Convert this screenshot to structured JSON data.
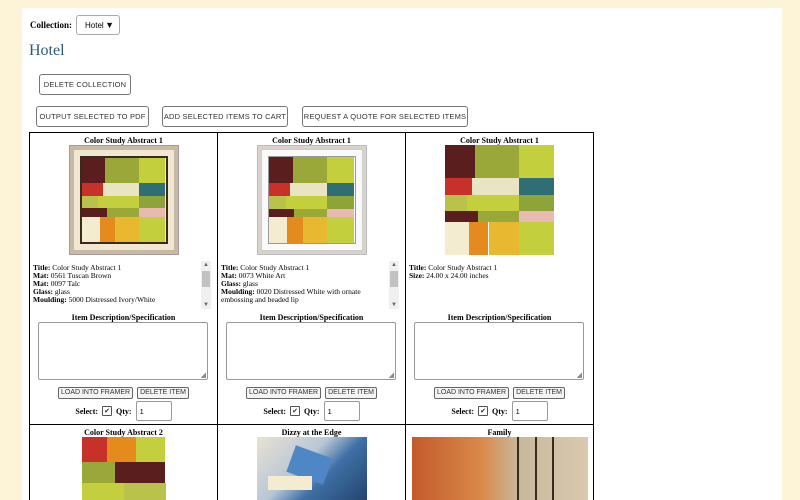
{
  "collection": {
    "label": "Collection:",
    "selected": "Hotel"
  },
  "page_title": "Hotel",
  "buttons": {
    "delete_collection": "DELETE COLLECTION",
    "output_pdf": "OUTPUT SELECTED TO PDF",
    "add_cart": "ADD SELECTED ITEMS TO CART",
    "request_quote": "REQUEST A QUOTE FOR SELECTED ITEMS"
  },
  "labels": {
    "item_desc": "Item Description/Specification",
    "load_framer": "LOAD INTO FRAMER",
    "delete_item": "DELETE ITEM",
    "select": "Select:",
    "qty": "Qty:",
    "check": "✔"
  },
  "items": [
    {
      "title": "Color Study Abstract 1",
      "specs": [
        {
          "k": "Title:",
          "v": "Color Study Abstract 1"
        },
        {
          "k": "Mat:",
          "v": "0561 Tuscan Brown"
        },
        {
          "k": "Mat:",
          "v": "0097 Talc"
        },
        {
          "k": "Glass:",
          "v": "glass"
        },
        {
          "k": "Moulding:",
          "v": "5000 Distressed Ivory/White"
        }
      ],
      "qty": "1"
    },
    {
      "title": "Color Study Abstract 1",
      "specs": [
        {
          "k": "Title:",
          "v": "Color Study Abstract 1"
        },
        {
          "k": "Mat:",
          "v": "0073 White Art"
        },
        {
          "k": "Glass:",
          "v": "glass"
        },
        {
          "k": "Moulding:",
          "v": "0020 Distressed White with ornate embossing and beaded lip"
        }
      ],
      "qty": "1"
    },
    {
      "title": "Color Study Abstract 1",
      "specs": [
        {
          "k": "Title:",
          "v": "Color Study Abstract 1"
        },
        {
          "k": "Size:",
          "v": "24.00 x 24.00 inches"
        }
      ],
      "qty": "1"
    }
  ],
  "row2_titles": [
    "Color Study Abstract 2",
    "Dizzy at the Edge",
    "Family"
  ],
  "palette": {
    "olive": "#9aa83a",
    "lime": "#c4cf3e",
    "teal": "#2f6f73",
    "red": "#c8302a",
    "maroon": "#5a1e1e",
    "orange": "#e58a1c",
    "gold": "#e8b830",
    "pink": "#e9b9b3",
    "cream": "#f3ecd0"
  }
}
